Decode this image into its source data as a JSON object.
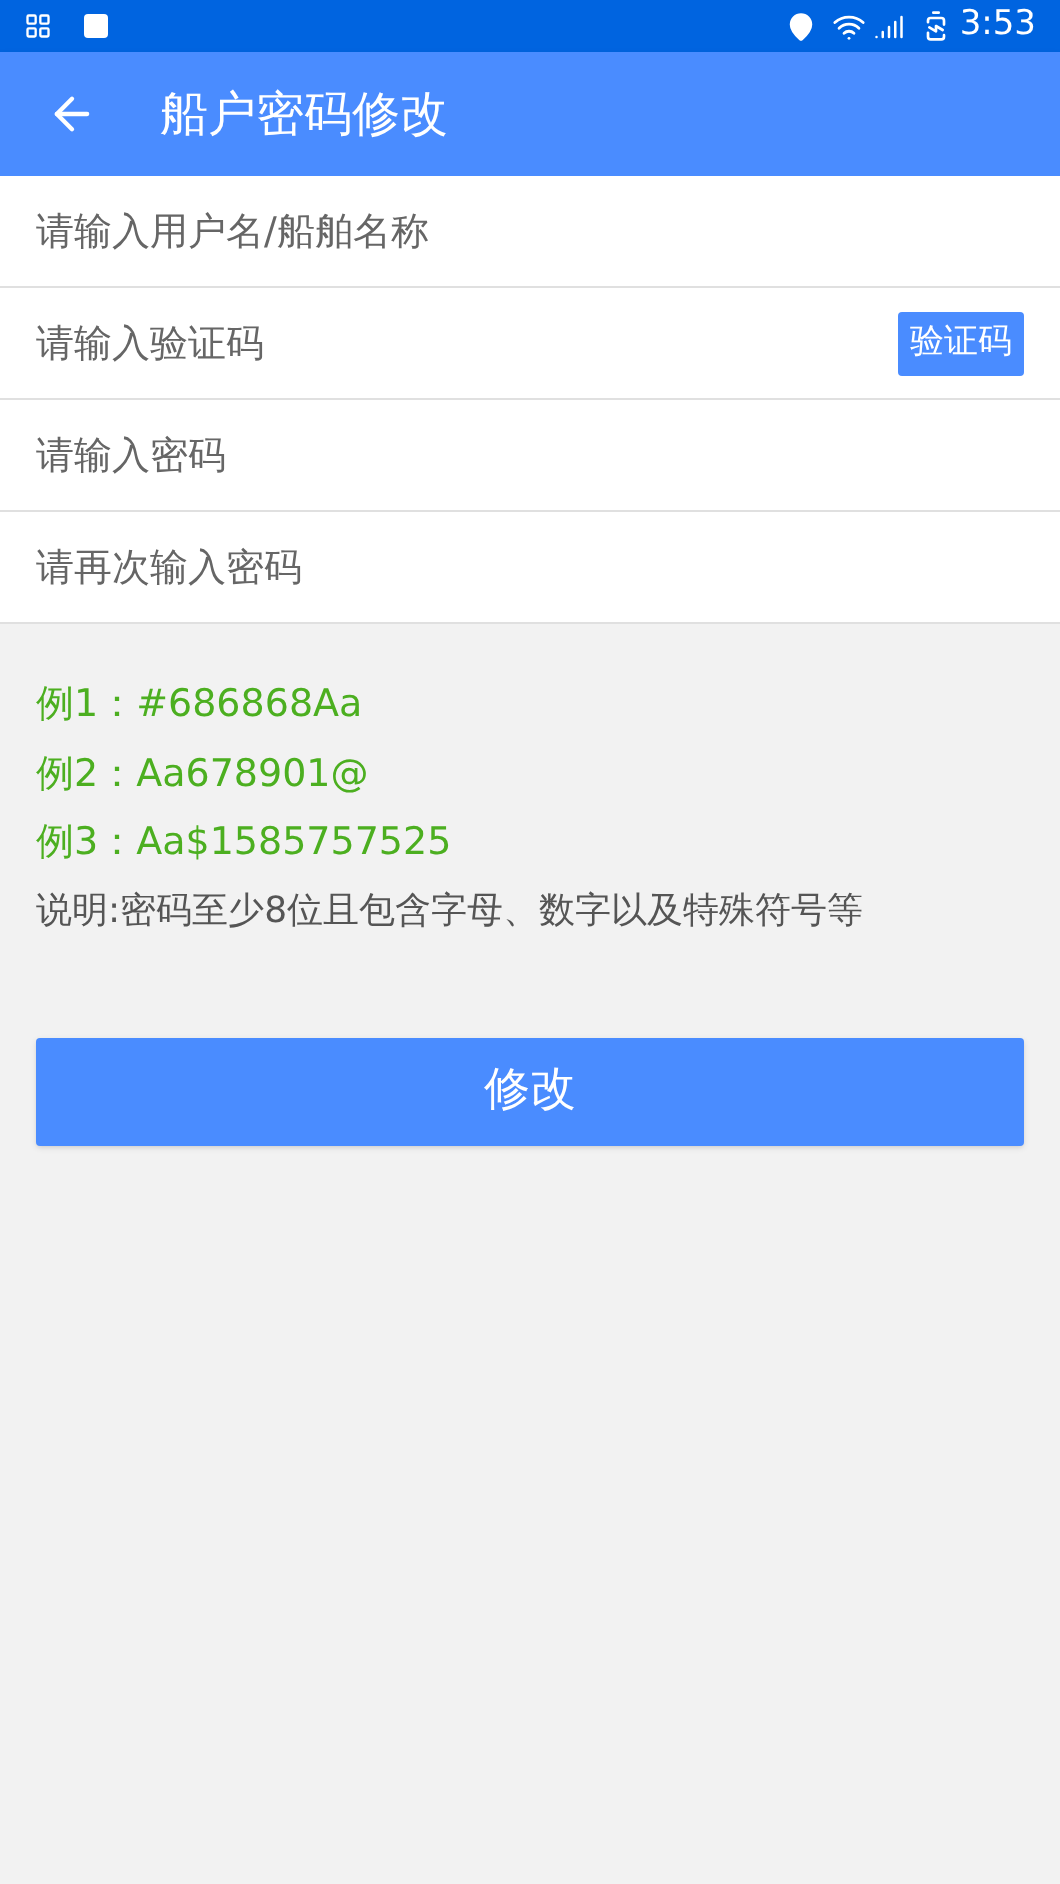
{
  "status_bar": {
    "time": "3:53"
  },
  "app_bar": {
    "title": "船户密码修改"
  },
  "fields": [
    {
      "placeholder": "请输入用户名/船舶名称"
    },
    {
      "placeholder": "请输入验证码",
      "button": "验证码"
    },
    {
      "placeholder": "请输入密码"
    },
    {
      "placeholder": "请再次输入密码"
    }
  ],
  "examples": [
    "例1：#686868Aa",
    "例2：Aa678901@",
    "例3：Aa$1585757525"
  ],
  "note": "说明:密码至少8位且包含字母、数字以及特殊符号等",
  "submit": "修改"
}
